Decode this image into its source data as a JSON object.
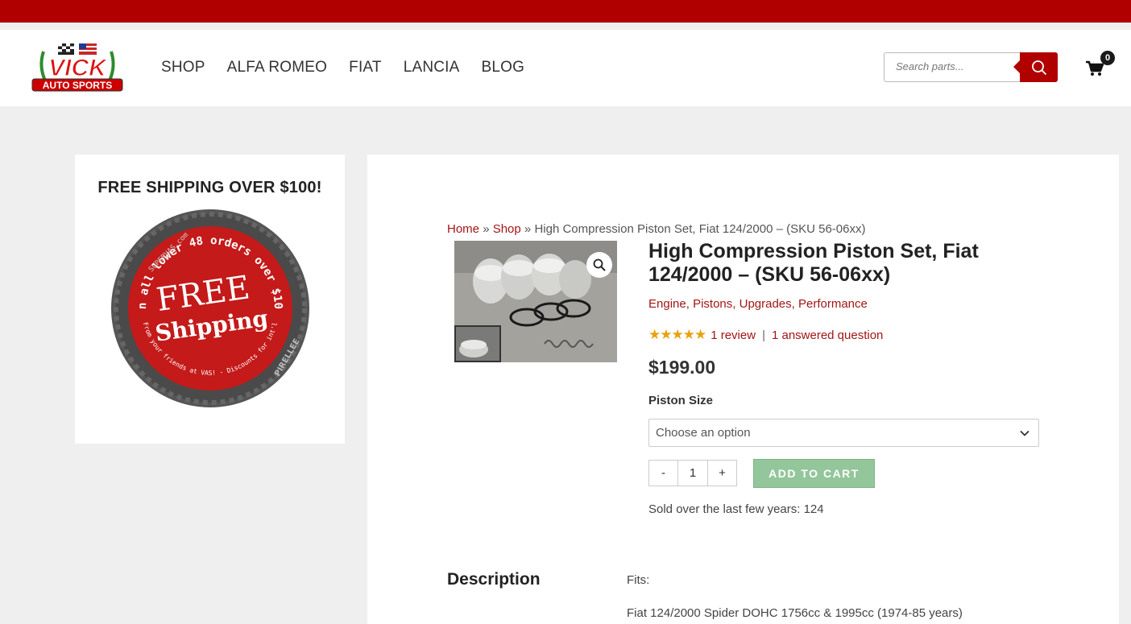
{
  "header": {
    "logo_text_top": "VICK",
    "logo_text_bottom": "AUTO SPORTS",
    "nav": [
      {
        "label": "SHOP"
      },
      {
        "label": "ALFA ROMEO"
      },
      {
        "label": "FIAT"
      },
      {
        "label": "LANCIA"
      },
      {
        "label": "BLOG"
      }
    ],
    "search": {
      "placeholder": "Search parts...",
      "icon": "search-icon"
    },
    "cart": {
      "icon": "cart-icon",
      "count": "0"
    }
  },
  "sidebar": {
    "title": "FREE SHIPPING OVER $100!",
    "badge": {
      "line1": "FREE",
      "line2": "Shipping",
      "ring_text": "On all lower 48 orders over $100",
      "ring_bottom": "From your friends at VAS! - Discounts for int'l",
      "brand_top": "SUPERVAS.com",
      "brand_side": "PIRELLEE"
    }
  },
  "product": {
    "breadcrumb": {
      "home": "Home",
      "shop": "Shop",
      "sep": "»",
      "current": "High Compression Piston Set, Fiat 124/2000 – (SKU 56-06xx)"
    },
    "title": "High Compression Piston Set, Fiat 124/2000 – (SKU 56-06xx)",
    "categories": [
      "Engine",
      "Pistons",
      "Upgrades",
      "Performance"
    ],
    "rating": {
      "stars": 5,
      "reviews": "1 review",
      "divider": "|",
      "questions": "1 answered question"
    },
    "price": "$199.00",
    "option_label": "Piston Size",
    "select_value": "Choose an option",
    "qty": {
      "minus": "-",
      "value": "1",
      "plus": "+"
    },
    "add_to_cart": "ADD TO CART",
    "sold_text": "Sold over the last few years: 124"
  },
  "description": {
    "heading": "Description",
    "fits_label": "Fits:",
    "fits_detail": "Fiat 124/2000 Spider DOHC 1756cc & 1995cc (1974-85 years)"
  },
  "colors": {
    "brand_red": "#b00000",
    "link_red": "#a31515",
    "atc_green": "#93c69b",
    "star": "#e8a20c"
  }
}
